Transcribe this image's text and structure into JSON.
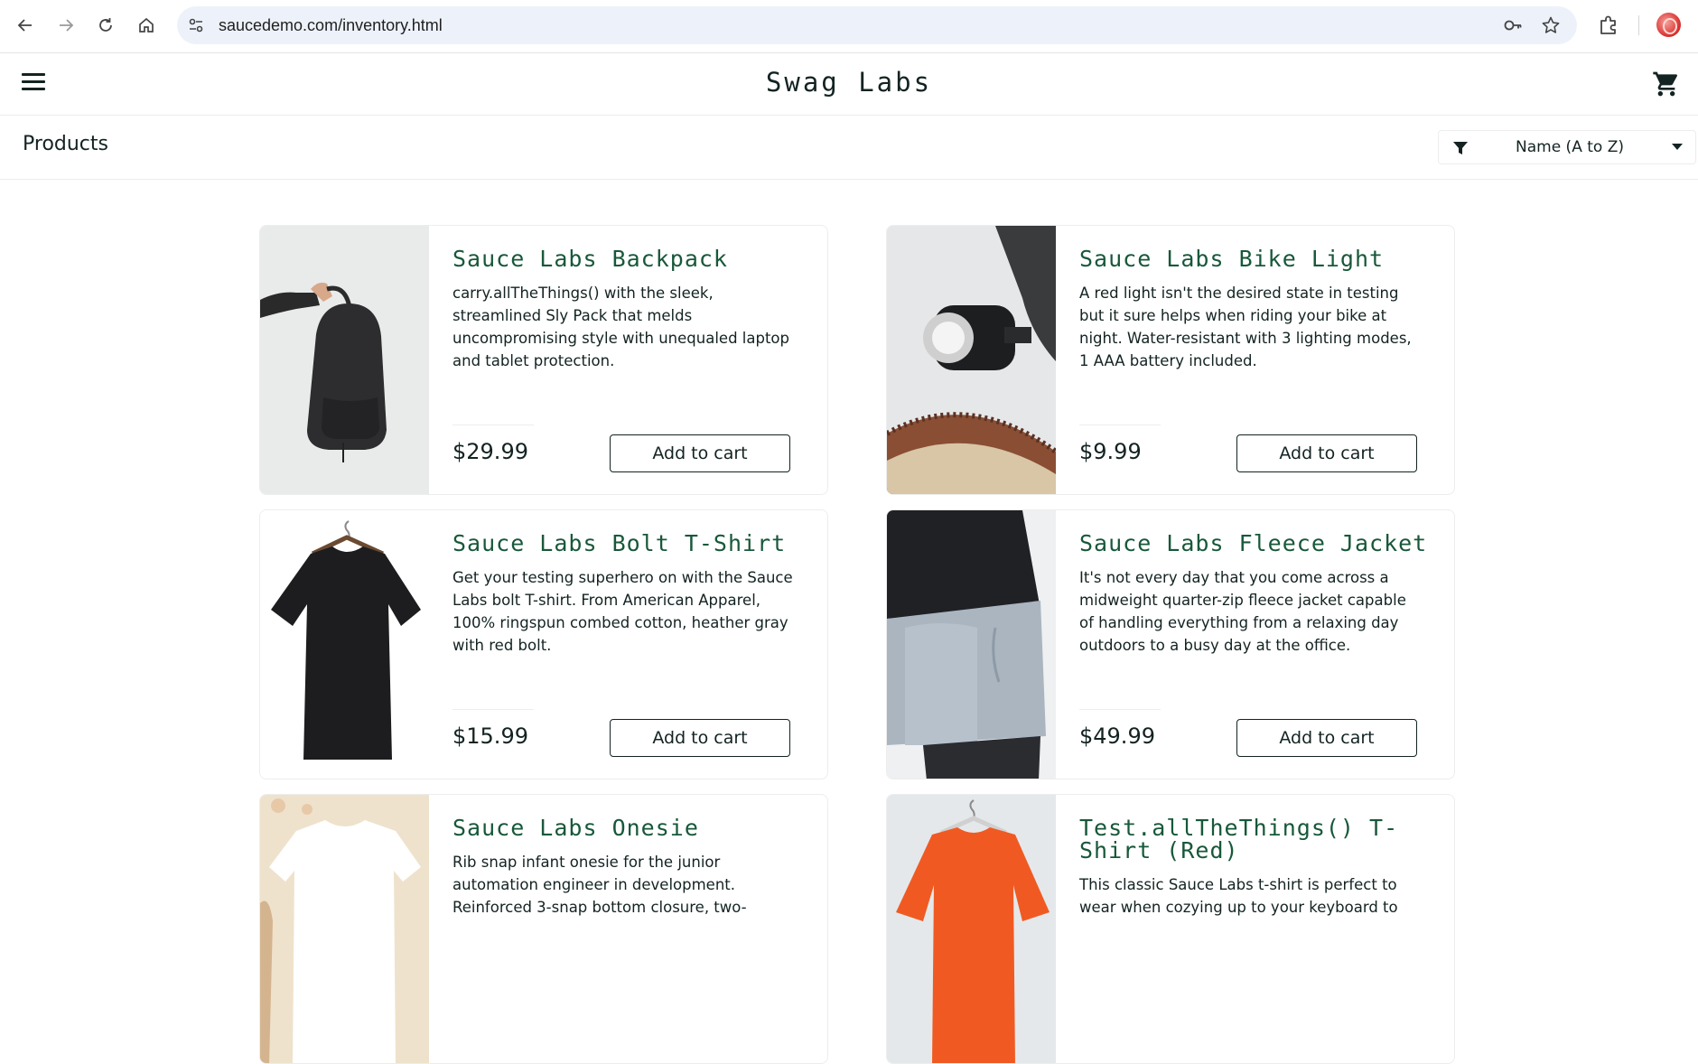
{
  "browser": {
    "url": "saucedemo.com/inventory.html"
  },
  "header": {
    "logo": "Swag Labs"
  },
  "secondary_header": {
    "title": "Products",
    "sort_selected": "Name (A to Z)"
  },
  "products": [
    {
      "name": "Sauce Labs Backpack",
      "description": "carry.allTheThings() with the sleek, streamlined Sly Pack that melds uncompromising style with unequaled laptop and tablet protection.",
      "price": "$29.99",
      "button": "Add to cart"
    },
    {
      "name": "Sauce Labs Bike Light",
      "description": "A red light isn't the desired state in testing but it sure helps when riding your bike at night. Water-resistant with 3 lighting modes, 1 AAA battery included.",
      "price": "$9.99",
      "button": "Add to cart"
    },
    {
      "name": "Sauce Labs Bolt T-Shirt",
      "description": "Get your testing superhero on with the Sauce Labs bolt T-shirt. From American Apparel, 100% ringspun combed cotton, heather gray with red bolt.",
      "price": "$15.99",
      "button": "Add to cart"
    },
    {
      "name": "Sauce Labs Fleece Jacket",
      "description": "It's not every day that you come across a midweight quarter-zip fleece jacket capable of handling everything from a relaxing day outdoors to a busy day at the office.",
      "price": "$49.99",
      "button": "Add to cart"
    },
    {
      "name": "Sauce Labs Onesie",
      "description": "Rib snap infant onesie for the junior automation engineer in development. Reinforced 3-snap bottom closure, two-"
    },
    {
      "name": "Test.allTheThings() T-Shirt (Red)",
      "description": "This classic Sauce Labs t-shirt is perfect to wear when cozying up to your keyboard to"
    }
  ]
}
